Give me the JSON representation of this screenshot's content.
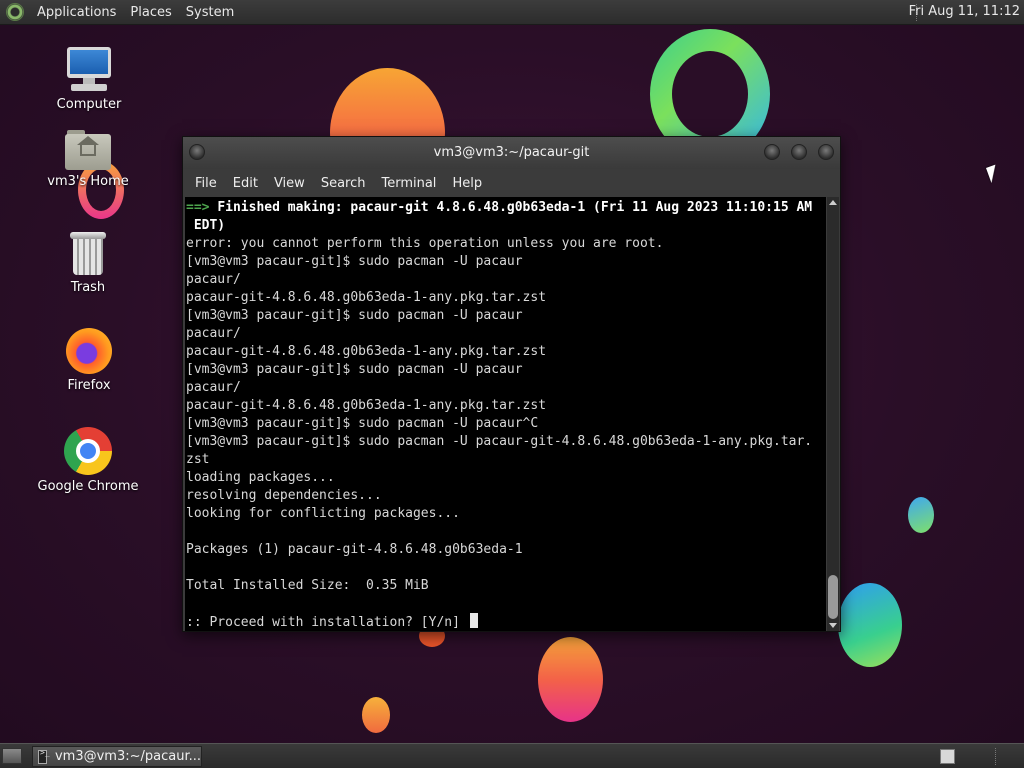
{
  "top_panel": {
    "menus": [
      "Applications",
      "Places",
      "System"
    ],
    "clock": "Fri Aug 11, 11:12"
  },
  "desktop": {
    "icons": [
      {
        "label": "Computer",
        "icon": "computer-icon"
      },
      {
        "label": "vm3's Home",
        "icon": "home-folder-icon"
      },
      {
        "label": "Trash",
        "icon": "trash-icon"
      },
      {
        "label": "Firefox",
        "icon": "firefox-icon"
      },
      {
        "label": "Google Chrome",
        "icon": "chrome-icon"
      }
    ]
  },
  "terminal_window": {
    "title": "vm3@vm3:~/pacaur-git",
    "menu": [
      "File",
      "Edit",
      "View",
      "Search",
      "Terminal",
      "Help"
    ],
    "lines": [
      {
        "prefix": "==> ",
        "text": "Finished making: pacaur-git 4.8.6.48.g0b63eda-1 (Fri 11 Aug 2023 11:10:15 AM",
        "style": "bold"
      },
      {
        "prefix": "",
        "text": " EDT)",
        "style": "bold"
      },
      {
        "prefix": "",
        "text": "error: you cannot perform this operation unless you are root.",
        "style": ""
      },
      {
        "prefix": "",
        "text": "[vm3@vm3 pacaur-git]$ sudo pacman -U pacaur",
        "style": ""
      },
      {
        "prefix": "",
        "text": "pacaur/",
        "style": ""
      },
      {
        "prefix": "",
        "text": "pacaur-git-4.8.6.48.g0b63eda-1-any.pkg.tar.zst",
        "style": ""
      },
      {
        "prefix": "",
        "text": "[vm3@vm3 pacaur-git]$ sudo pacman -U pacaur",
        "style": ""
      },
      {
        "prefix": "",
        "text": "pacaur/",
        "style": ""
      },
      {
        "prefix": "",
        "text": "pacaur-git-4.8.6.48.g0b63eda-1-any.pkg.tar.zst",
        "style": ""
      },
      {
        "prefix": "",
        "text": "[vm3@vm3 pacaur-git]$ sudo pacman -U pacaur",
        "style": ""
      },
      {
        "prefix": "",
        "text": "pacaur/",
        "style": ""
      },
      {
        "prefix": "",
        "text": "pacaur-git-4.8.6.48.g0b63eda-1-any.pkg.tar.zst",
        "style": ""
      },
      {
        "prefix": "",
        "text": "[vm3@vm3 pacaur-git]$ sudo pacman -U pacaur^C",
        "style": ""
      },
      {
        "prefix": "",
        "text": "[vm3@vm3 pacaur-git]$ sudo pacman -U pacaur-git-4.8.6.48.g0b63eda-1-any.pkg.tar.",
        "style": ""
      },
      {
        "prefix": "",
        "text": "zst",
        "style": ""
      },
      {
        "prefix": "",
        "text": "loading packages...",
        "style": ""
      },
      {
        "prefix": "",
        "text": "resolving dependencies...",
        "style": ""
      },
      {
        "prefix": "",
        "text": "looking for conflicting packages...",
        "style": ""
      },
      {
        "prefix": "",
        "text": "",
        "style": ""
      },
      {
        "prefix": "",
        "text": "Packages (1) pacaur-git-4.8.6.48.g0b63eda-1",
        "style": ""
      },
      {
        "prefix": "",
        "text": "",
        "style": ""
      },
      {
        "prefix": "",
        "text": "Total Installed Size:  0.35 MiB",
        "style": ""
      },
      {
        "prefix": "",
        "text": "",
        "style": ""
      },
      {
        "prefix": "",
        "text": ":: Proceed with installation? [Y/n] ",
        "style": "prompt"
      }
    ]
  },
  "bottom_panel": {
    "task_label": "vm3@vm3:~/pacaur..."
  },
  "colors": {
    "terminal_bg": "#000000",
    "terminal_fg": "#d8d8d8",
    "arrow_green": "#4ea64e",
    "panel_bg": "#2c2c2c"
  }
}
